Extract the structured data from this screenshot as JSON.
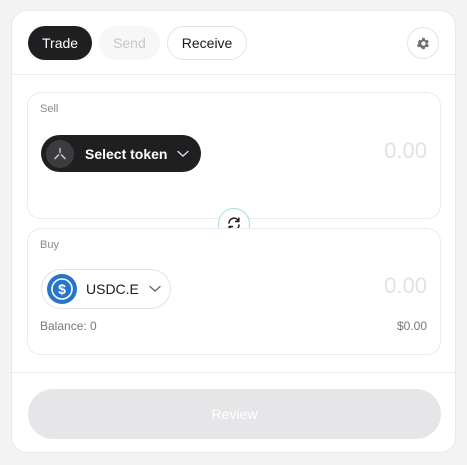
{
  "tabs": [
    {
      "label": "Trade",
      "state": "active"
    },
    {
      "label": "Send",
      "state": "disabled"
    },
    {
      "label": "Receive",
      "state": "outline"
    }
  ],
  "settings_icon": "gear-icon",
  "sell": {
    "label": "Sell",
    "token_button_label": "Select token",
    "amount_placeholder": "0.00"
  },
  "swap_icon": "swap-arrows-icon",
  "buy": {
    "label": "Buy",
    "token_symbol": "USDC.E",
    "amount_placeholder": "0.00",
    "balance_text": "Balance: 0",
    "usd_value": "$0.00"
  },
  "review_label": "Review",
  "colors": {
    "dark_pill": "#1f1f21",
    "usdc_blue": "#2775ca",
    "swap_ring": "#a6e4c9",
    "review_bg": "#e6e6e8"
  }
}
